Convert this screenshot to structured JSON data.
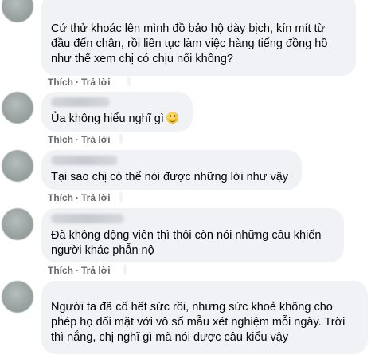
{
  "comments": [
    {
      "text": "Cứ thử khoác lên mình đồ bảo hộ dày bịch, kín mít từ đầu đến chân, rồi liên tục làm việc hàng tiếng đồng hồ như thế xem chị có chịu nổi không?"
    },
    {
      "text": "Ủa không hiểu nghĩ gì",
      "emoji": "slightly-smiling-face-icon"
    },
    {
      "text": "Tại sao chị có thể nói được những lời như vậy"
    },
    {
      "text": "Đã không động viên thì thôi còn nói những câu khiến người khác phẫn nộ"
    },
    {
      "text": "Người ta đã cố hết sức rồi, nhưng sức khoẻ không cho phép họ đối mặt với vô số mẫu xét nghiệm mỗi ngày. Trời thì nắng, chị nghĩ gì mà nói được câu kiểu vậy"
    }
  ],
  "actions": {
    "like": "Thích",
    "reply": "Trả lời",
    "separator": "·"
  }
}
